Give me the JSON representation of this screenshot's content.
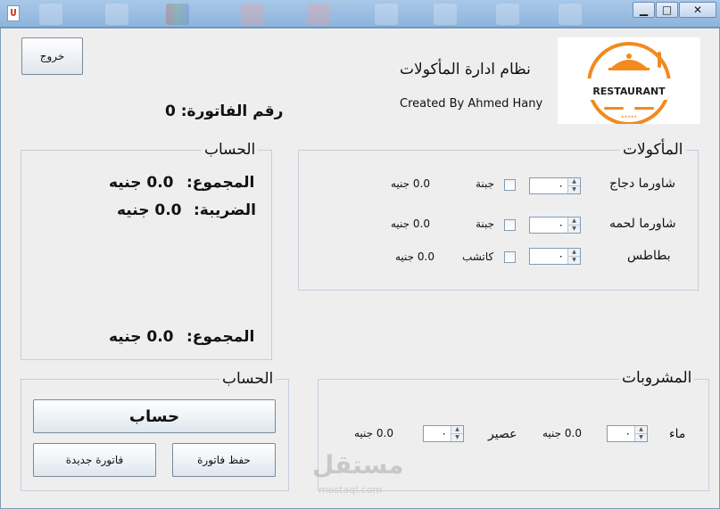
{
  "window": {
    "minimize_glyph": "▁",
    "maximize_glyph": "□",
    "close_glyph": "✕"
  },
  "header": {
    "exit_label": "خروج",
    "app_title": "نظام ادارة المأكولات",
    "credit": "Created By Ahmed Hany",
    "invoice_label": "رقم الفاتورة: 0",
    "logo_text": "RESTAURANT",
    "logo_stars": "★★★★★",
    "logo_brand_color": "#f28a1e"
  },
  "account_panel": {
    "title": "الحساب",
    "total_label": "المجموع:",
    "total_value": "0.0 جنيه",
    "tax_label": "الضريبة:",
    "tax_value": "0.0 جنيه",
    "grand_total_label": "المجموع:",
    "grand_total_value": "0.0 جنيه"
  },
  "food_panel": {
    "title": "المأكولات",
    "items": [
      {
        "name": "شاورما دجاج",
        "qty": "٠",
        "option": "جبنة",
        "price": "0.0 جنيه"
      },
      {
        "name": "شاورما لحمه",
        "qty": "٠",
        "option": "جبنة",
        "price": "0.0 جنيه"
      },
      {
        "name": "بطاطس",
        "qty": "٠",
        "option": "كاتشب",
        "price": "0.0 جنيه"
      }
    ]
  },
  "actions_panel": {
    "title": "الحساب",
    "calculate_label": "حساب",
    "save_invoice_label": "حفظ فاتورة",
    "new_invoice_label": "فاتورة جديدة"
  },
  "drinks_panel": {
    "title": "المشروبات",
    "items": [
      {
        "name": "ماء",
        "qty": "٠",
        "price": "0.0 جنيه"
      },
      {
        "name": "عصير",
        "qty": "٠",
        "price": "0.0 جنيه"
      }
    ]
  },
  "watermark": {
    "text": "مستقل",
    "sub": "mostaql.com"
  }
}
